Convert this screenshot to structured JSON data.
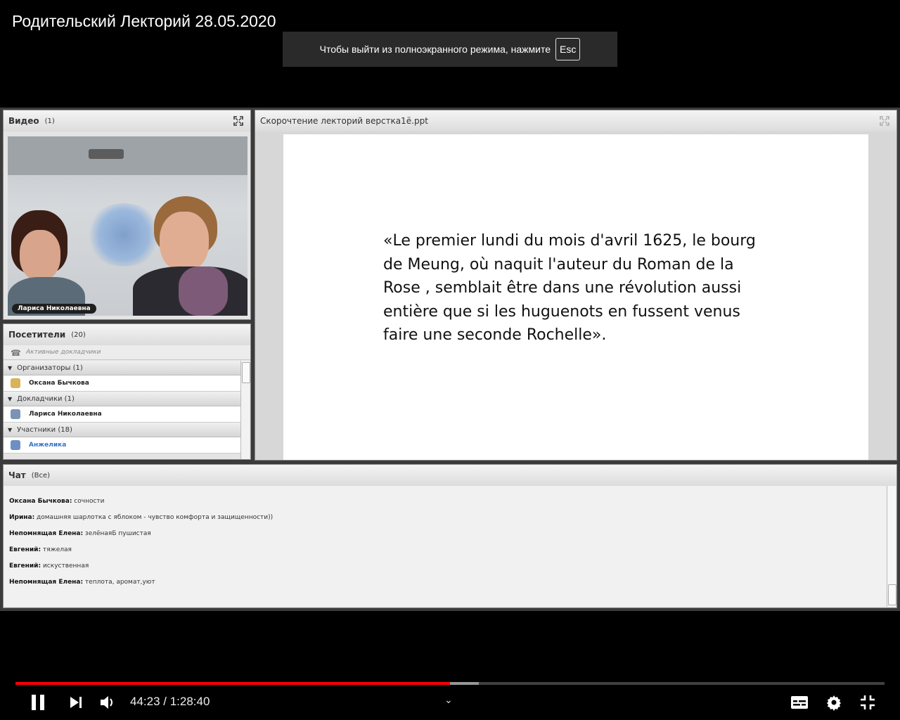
{
  "video": {
    "title": "Родительский Лекторий 28.05.2020",
    "fullscreen_notice": "Чтобы выйти из полноэкранного режима, нажмите",
    "esc_key": "Esc",
    "current_time": "44:23",
    "duration": "1:28:40",
    "time_display": "44:23 / 1:28:40",
    "played_fraction": 0.5,
    "buffered_fraction": 0.533
  },
  "video_pod": {
    "title": "Видео",
    "count": "(1)",
    "speaker_label": "Лариса Николаевна"
  },
  "attendees_pod": {
    "title": "Посетители",
    "count": "(20)",
    "active_speakers": "Активные докладчики",
    "groups": [
      {
        "label": "Организаторы (1)",
        "members": [
          "Оксана Бычкова"
        ]
      },
      {
        "label": "Докладчики (1)",
        "members": [
          "Лариса Николаевна"
        ]
      },
      {
        "label": "Участники (18)",
        "members": [
          "Анжелика"
        ]
      }
    ]
  },
  "share_pod": {
    "title": "Скорочтение лекторий верстка1ё.ppt",
    "slide_lines": [
      "«Le premier lundi du mois d'avril 1625, le bourg",
      "de Meung, où naquit l'auteur du Roman de la",
      "Rose , semblait être dans une révolution aussi",
      "entière que si les huguenots en fussent venus",
      "faire une seconde Rochelle»."
    ]
  },
  "chat_pod": {
    "title": "Чат",
    "filter": "(Все)",
    "messages": [
      {
        "author": "Оксана Бычкова:",
        "text": " сочности"
      },
      {
        "author": "Ирина:",
        "text": " домашняя шарлотка с яблоком - чувство комфорта и защищенности))"
      },
      {
        "author": "Непомнящая Елена:",
        "text": " зелёнаяБ пушистая"
      },
      {
        "author": "Евгений:",
        "text": " тяжелая"
      },
      {
        "author": "Евгений:",
        "text": " искуственная"
      },
      {
        "author": "Непомнящая Елена:",
        "text": " теплота, аромат,уют"
      }
    ]
  },
  "colors": {
    "progress_played": "#ff0000",
    "link_blue": "#3a73c4"
  }
}
